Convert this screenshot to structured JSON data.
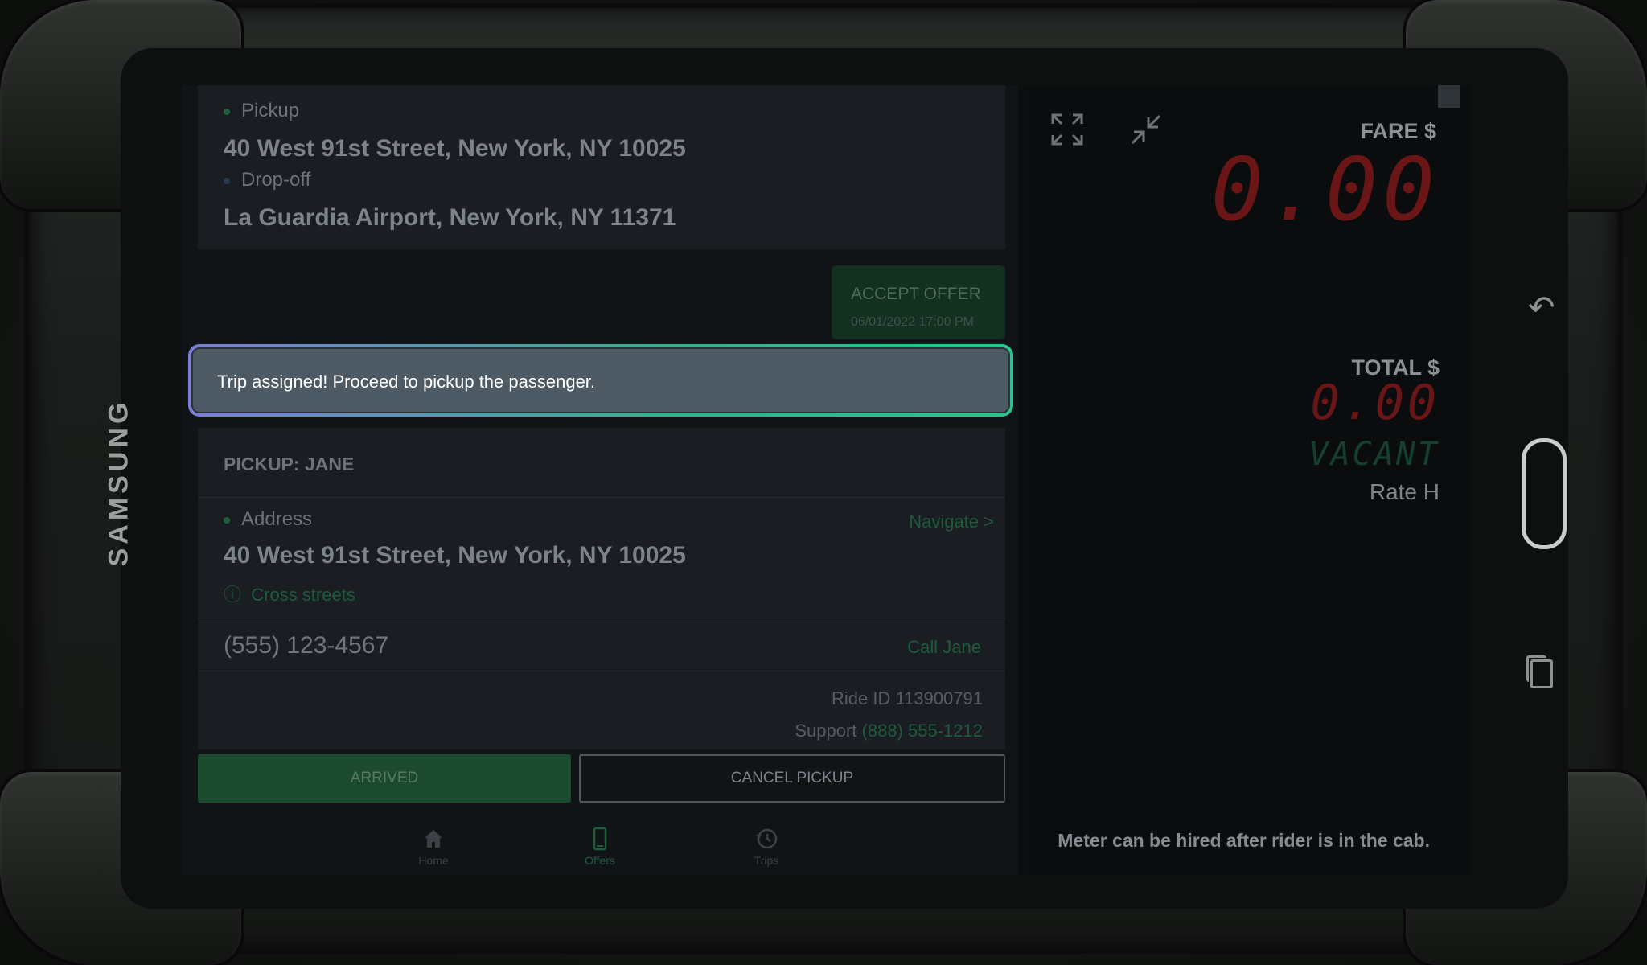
{
  "device": {
    "brand": "SAMSUNG"
  },
  "route": {
    "pickup_label": "Pickup",
    "pickup_address": "40 West 91st Street, New York, NY 10025",
    "dropoff_label": "Drop-off",
    "dropoff_address": "La Guardia Airport, New York, NY 11371"
  },
  "offer": {
    "label": "ACCEPT OFFER",
    "datetime": "06/01/2022 17:00 PM"
  },
  "toast": {
    "message": "Trip assigned! Proceed to pickup the passenger."
  },
  "pickup": {
    "title": "PICKUP: JANE",
    "address_label": "Address",
    "navigate_label": "Navigate >",
    "address": "40 West 91st Street, New York, NY 10025",
    "cross_streets_label": "Cross streets",
    "phone": "(555) 123-4567",
    "call_label": "Call Jane",
    "ride_id": "Ride ID 113900791",
    "support_label": "Support",
    "support_phone": "(888) 555-1212"
  },
  "actions": {
    "arrived_label": "ARRIVED",
    "cancel_label": "CANCEL PICKUP"
  },
  "tabs": [
    {
      "label": "Home",
      "icon": "home-icon",
      "active": false
    },
    {
      "label": "Offers",
      "icon": "phone-icon",
      "active": true
    },
    {
      "label": "Trips",
      "icon": "history-icon",
      "active": false
    }
  ],
  "meter": {
    "fare_label": "FARE $",
    "fare_value": "0.00",
    "total_label": "TOTAL $",
    "total_value": "0.00",
    "status": "VACANT",
    "rate": "Rate H",
    "note": "Meter can be hired after rider is in the cab."
  },
  "colors": {
    "accent_green": "#1f5d3c",
    "meter_red": "#6b1616",
    "toast_bg": "#4e5a63"
  }
}
